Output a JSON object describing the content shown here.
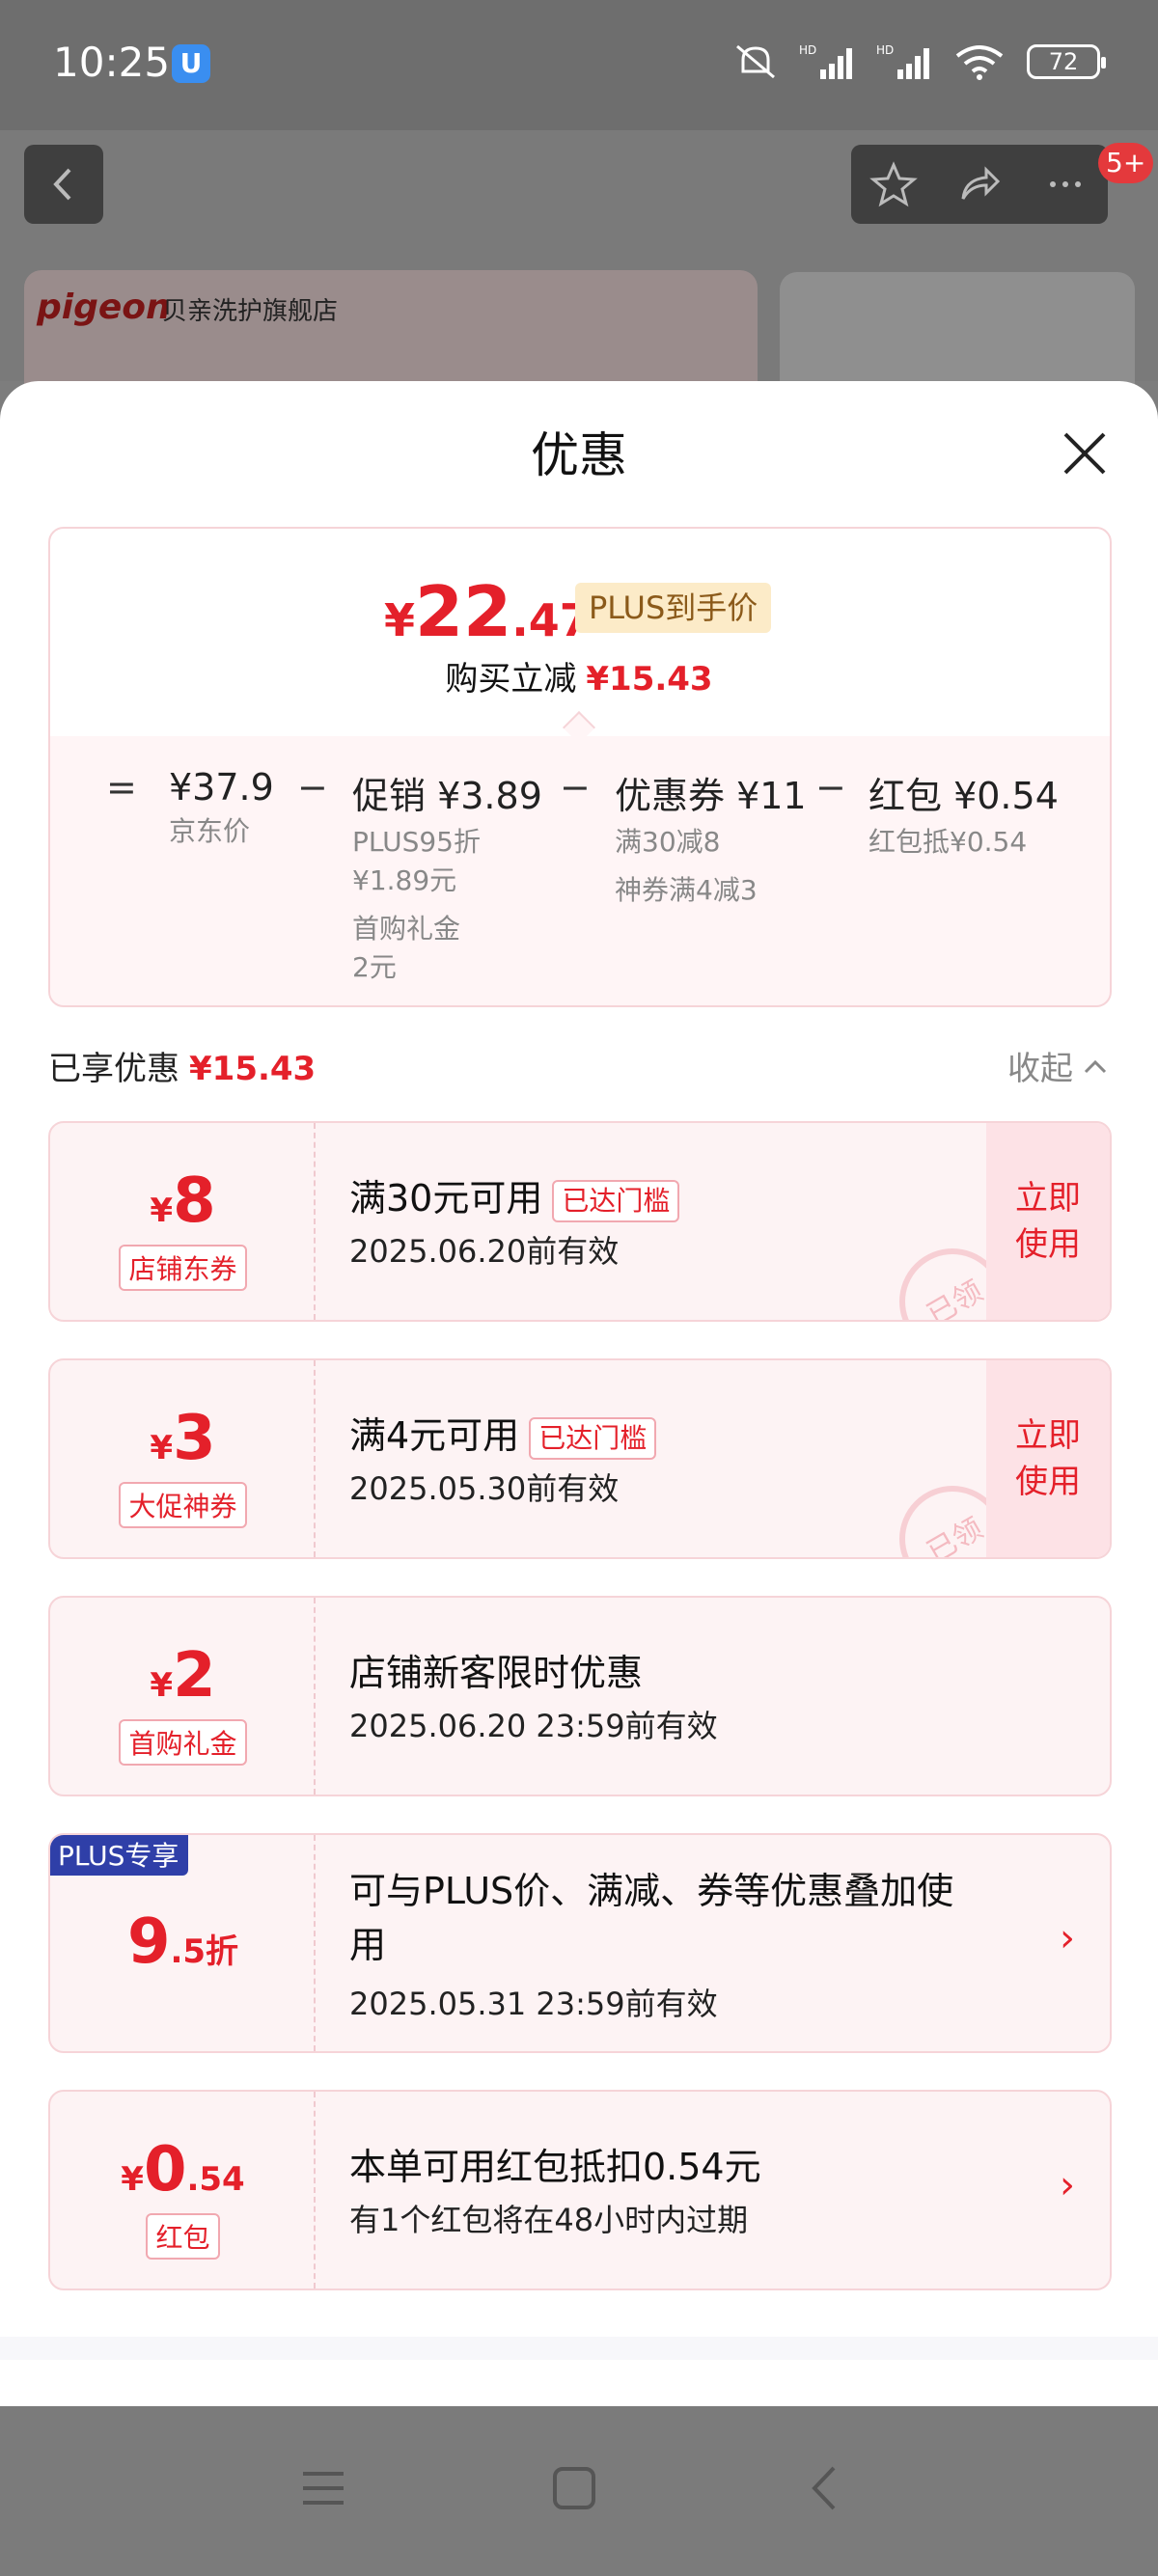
{
  "status_bar": {
    "time": "10:25",
    "app_icon": "U",
    "battery": "72"
  },
  "background": {
    "notification_count": "5+",
    "banner_logo": "pigeon",
    "banner_shop": "贝亲洗护旗舰店"
  },
  "sheet": {
    "title": "优惠"
  },
  "price_summary": {
    "currency": "¥",
    "price_int": "22",
    "price_dec": ".47",
    "plus_label": "PLUS到手价",
    "reduce_label": "购买立减",
    "reduce_amount": "¥15.43",
    "formula": {
      "eq": "=",
      "minus": "−",
      "jd_price": "¥37.9",
      "jd_price_label": "京东价",
      "promo": "促销 ¥3.89",
      "promo_lines": [
        "PLUS95折",
        "¥1.89元",
        "首购礼金",
        "2元"
      ],
      "coupon": "优惠券 ¥11",
      "coupon_lines": [
        "满30减8",
        "神券满4减3"
      ],
      "redpacket": "红包 ¥0.54",
      "redpacket_lines": [
        "红包抵¥0.54"
      ]
    }
  },
  "enjoyed": {
    "label": "已享优惠",
    "amount": "¥15.43",
    "collapse_label": "收起"
  },
  "coupons": [
    {
      "currency": "¥",
      "amount": "8",
      "type": "店铺东券",
      "title": "满30元可用",
      "badge": "已达门槛",
      "date": "2025.06.20前有效",
      "action": "立即使用",
      "stamp": "已领"
    },
    {
      "currency": "¥",
      "amount": "3",
      "type": "大促神券",
      "title": "满4元可用",
      "badge": "已达门槛",
      "date": "2025.05.30前有效",
      "action": "立即使用",
      "stamp": "已领"
    },
    {
      "currency": "¥",
      "amount": "2",
      "type": "首购礼金",
      "title": "店铺新客限时优惠",
      "date": "2025.06.20 23:59前有效"
    },
    {
      "plus_badge": "PLUS专享",
      "amount": "9",
      "suffix": ".5折",
      "title_line1": "可与PLUS价、满减、券等优惠叠加使",
      "title_line2": "用",
      "date": "2025.05.31 23:59前有效"
    },
    {
      "currency": "¥",
      "amount": "0",
      "suffix": ".54",
      "type": "红包",
      "title": "本单可用红包抵扣0.54元",
      "date": "有1个红包将在48小时内过期"
    }
  ],
  "colors": {
    "accent_red": "#e4202a",
    "plus_gold": "#fcebc8",
    "plus_blue": "#2f3fa8"
  }
}
